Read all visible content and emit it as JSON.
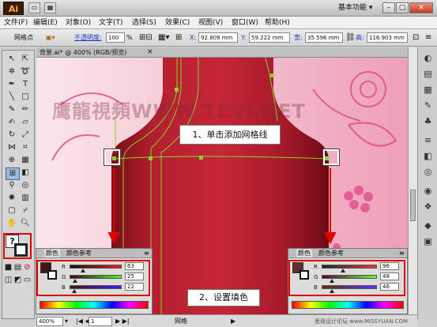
{
  "app": {
    "logo": "Ai",
    "workspace": "基本功能 ▾"
  },
  "menu": [
    "文件(F)",
    "编辑(E)",
    "对象(O)",
    "文字(T)",
    "选择(S)",
    "效果(C)",
    "视图(V)",
    "窗口(W)",
    "帮助(H)"
  ],
  "control": {
    "tool_name": "网格点",
    "opacity_label": "不透明度:",
    "opacity_value": "100",
    "opacity_unit": "%",
    "x_label": "X:",
    "x_value": "92.809 mm",
    "y_label": "Y:",
    "y_value": "59.222 mm",
    "w_label": "宽:",
    "w_value": "35.596 mm",
    "h_label": "高:",
    "h_value": "116.903 mm"
  },
  "document": {
    "tab_title": "背景.ai* @ 400% (RGB/预览)",
    "tab_close": "×"
  },
  "watermark": "鹰龍視頻WWW.TEVI.NET",
  "callouts": {
    "step1": "1、单击添加网格线",
    "step2": "2、设置填色"
  },
  "panel_left": {
    "tab_color": "颜色",
    "tab_guide": "颜色参考",
    "channels": [
      {
        "label": "R",
        "value": "63",
        "fraction": 0.25
      },
      {
        "label": "G",
        "value": "25",
        "fraction": 0.1
      },
      {
        "label": "B",
        "value": "22",
        "fraction": 0.09
      }
    ],
    "swatch_color": "#3f1916"
  },
  "panel_right": {
    "tab_color": "颜色",
    "tab_guide": "颜色参考",
    "channels": [
      {
        "label": "R",
        "value": "96",
        "fraction": 0.38
      },
      {
        "label": "G",
        "value": "48",
        "fraction": 0.19
      },
      {
        "label": "B",
        "value": "46",
        "fraction": 0.18
      }
    ],
    "swatch_color": "#60302e"
  },
  "status": {
    "zoom": "400%",
    "page": "1",
    "tool": "网格",
    "footer_watermark": "思缘设计论坛 www.MISSYUAN.COM"
  },
  "colors": {
    "accent_red": "#e10000",
    "bottle_red": "#b01c2a",
    "mesh_green": "#8ad12e",
    "canvas_pink": "#f6d6df"
  }
}
